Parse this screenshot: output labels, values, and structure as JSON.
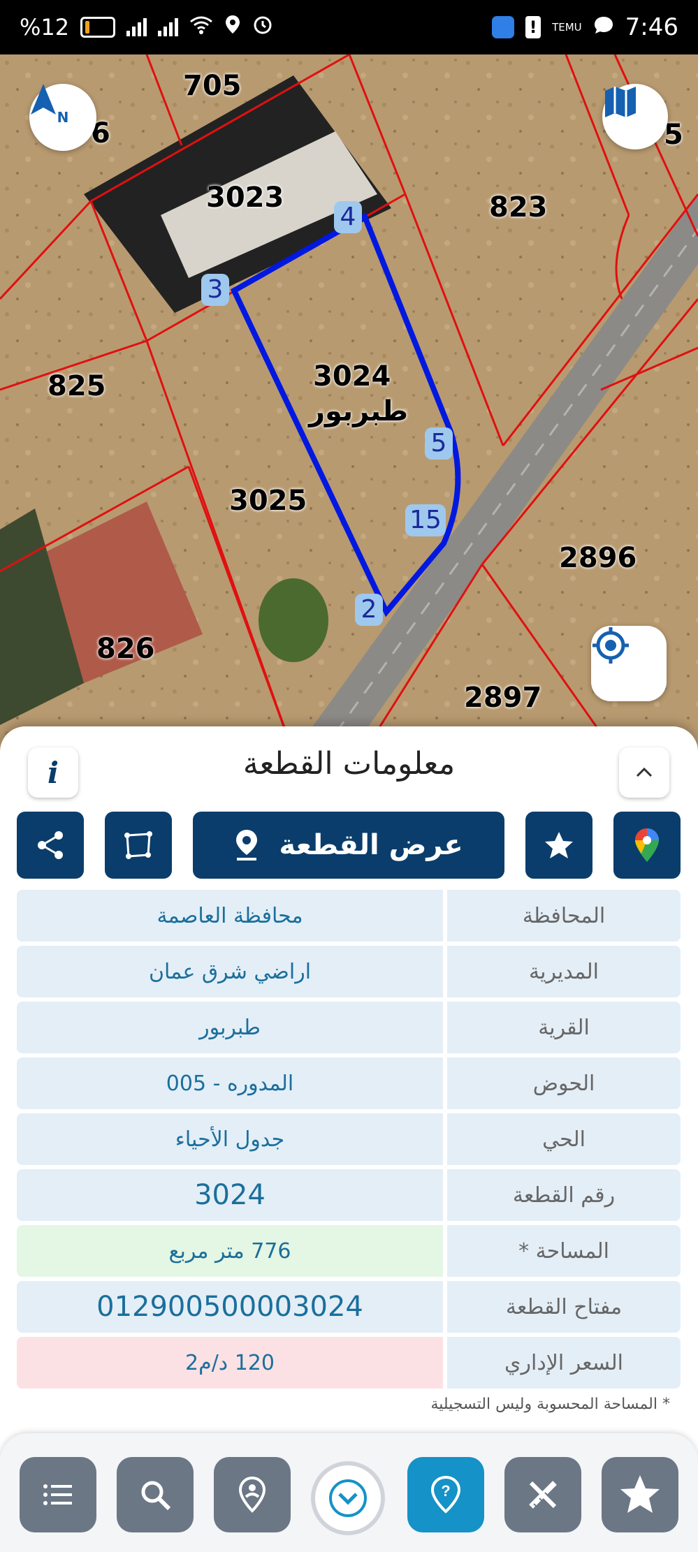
{
  "status_bar": {
    "battery": "%12",
    "time": "7:46",
    "temu_label": "TEMU"
  },
  "map": {
    "parcel_labels": [
      "705",
      "6",
      "3023",
      "823",
      "825",
      "3024",
      "3025",
      "2896",
      "826",
      "2897",
      "5"
    ],
    "selected_parcel_number": "3024",
    "selected_parcel_village": "طبربور",
    "vertex_labels": [
      "4",
      "3",
      "5",
      "15",
      "2"
    ],
    "compass_letter": "N"
  },
  "sheet": {
    "title": "معلومات القطعة",
    "info_button_glyph": "i",
    "view_parcel_label": "عرض القطعة",
    "rows": [
      {
        "label": "المحافظة",
        "value": "محافظة العاصمة"
      },
      {
        "label": "المديرية",
        "value": "اراضي شرق عمان"
      },
      {
        "label": "القرية",
        "value": "طبربور"
      },
      {
        "label": "الحوض",
        "value": "المدوره - 005"
      },
      {
        "label": "الحي",
        "value": "جدول الأحياء"
      },
      {
        "label": "رقم القطعة",
        "value": "3024"
      },
      {
        "label": "المساحة *",
        "value": "776  متر مربع"
      },
      {
        "label": "مفتاح القطعة",
        "value": "012900500003024"
      },
      {
        "label": "السعر الإداري",
        "value": "120 د/م2"
      }
    ],
    "footnote": "* المساحة المحسوبة وليس التسجيلية"
  },
  "colors": {
    "primary": "#0a3d6b",
    "accent": "#1592c7",
    "parcel_outline": "#0018e0",
    "boundary": "#e01010"
  }
}
